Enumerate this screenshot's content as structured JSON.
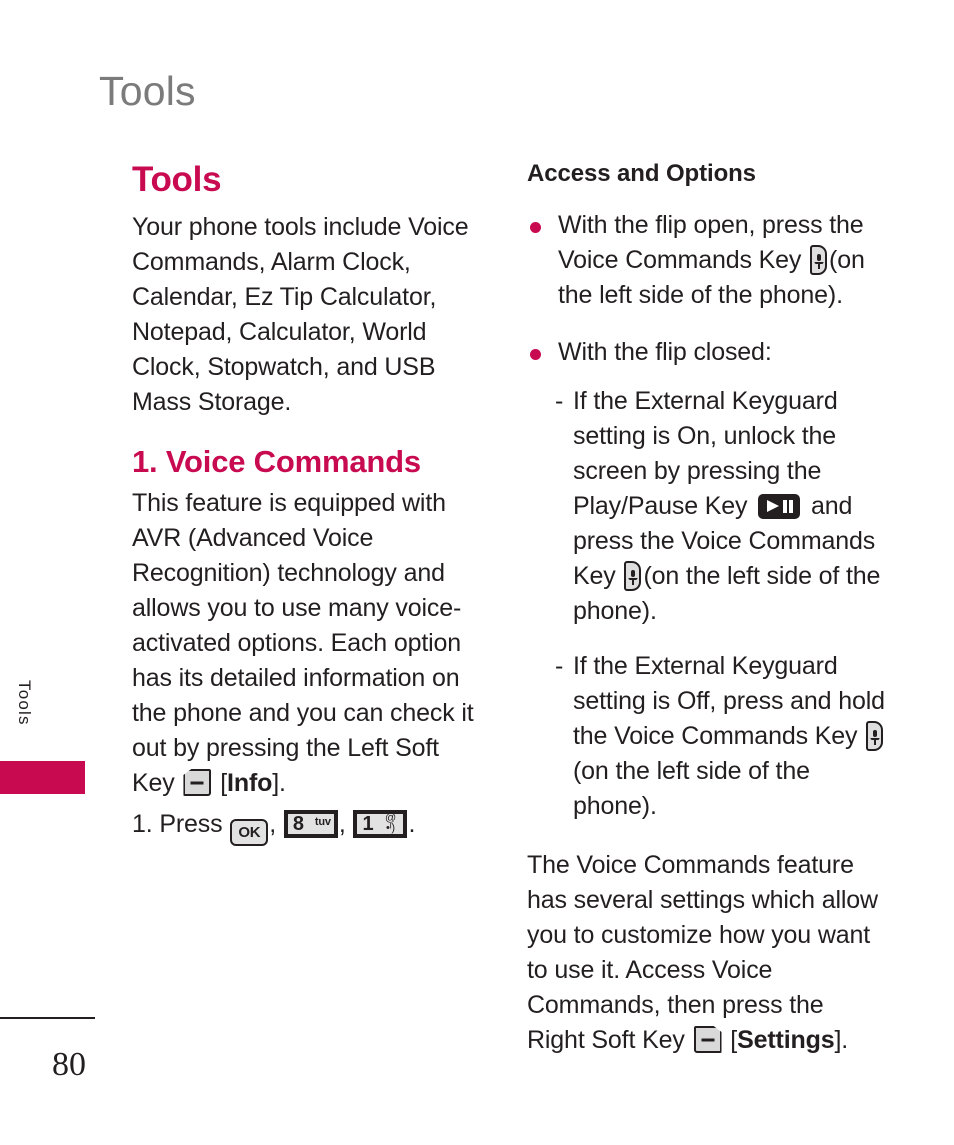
{
  "colors": {
    "accent": "#c80a50",
    "header_gray": "#7b7b7b",
    "body_text": "#231f20"
  },
  "running_header": "Tools",
  "side_tab": {
    "label": "Tools"
  },
  "footer": {
    "page_number": "80"
  },
  "left_column": {
    "section_title": "Tools",
    "intro_paragraph": "Your phone tools include Voice Commands, Alarm Clock, Calendar, Ez Tip Calculator, Notepad, Calculator, World Clock, Stopwatch, and USB Mass Storage.",
    "sub_title": "1. Voice Commands",
    "feature_paragraph_part1": "This feature is equipped with AVR (Advanced Voice Recognition) technology and allows you to use many voice-activated options. Each option has its detailed information on the phone and you can check it out by pressing the Left Soft Key",
    "feature_paragraph_bracket_open": "[",
    "feature_paragraph_bold": "Info",
    "feature_paragraph_bracket_close": "].",
    "step": {
      "number": "1. Press",
      "comma1": ",",
      "comma2": ",",
      "period": ".",
      "key_ok": "OK",
      "key_8_digit": "8",
      "key_8_letters": "tuv",
      "key_1_digit": "1",
      "key_1_symbol_top": "@",
      "key_1_symbol_bottom": "•ᴵ)"
    }
  },
  "right_column": {
    "heading": "Access and Options",
    "bullets": [
      {
        "text_before_icon": "With the flip open, press the Voice Commands Key",
        "icon": "voice-commands-key-icon",
        "text_after_icon": "(on the left side of the phone)."
      },
      {
        "text_before_icon": "With the flip closed:",
        "icon": "",
        "text_after_icon": ""
      }
    ],
    "sub_items": [
      {
        "dash": "-",
        "part1": "If the External Keyguard setting is On, unlock the screen by pressing the Play/Pause Key",
        "icon1": "play-pause-key-icon",
        "part2": "and press the Voice Commands Key",
        "icon2": "voice-commands-key-icon",
        "part3": "(on the left side of the phone)."
      },
      {
        "dash": "-",
        "part1": "If the External Keyguard setting is Off, press and hold the Voice Commands Key",
        "icon1": "voice-commands-key-icon",
        "part2": "(on the left side of the phone).",
        "icon2": "",
        "part3": ""
      }
    ],
    "closing_paragraph_part1": "The Voice Commands feature has several settings which allow you to customize how you want to use it. Access Voice Commands, then press the Right Soft Key",
    "closing_bracket_open": "[",
    "closing_bold": "Settings",
    "closing_bracket_close": "]."
  }
}
